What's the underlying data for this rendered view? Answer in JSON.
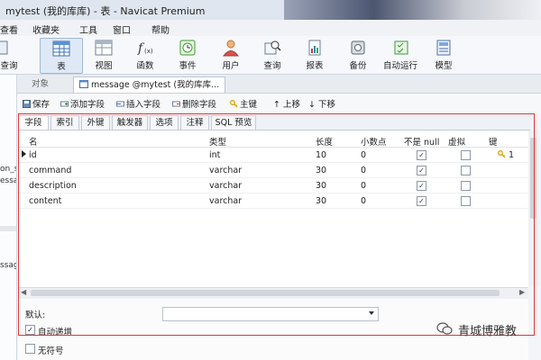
{
  "window": {
    "title": "mytest (我的库库) - 表 - Navicat Premium"
  },
  "menubar": {
    "items": [
      "查看",
      "收藏夹",
      "工具",
      "窗口",
      "帮助"
    ]
  },
  "toolbar": {
    "left_fragment": "查询",
    "buttons": [
      {
        "label": "表",
        "icon": "table-icon",
        "active": true
      },
      {
        "label": "视图",
        "icon": "view-icon"
      },
      {
        "label": "函数",
        "icon": "function-icon"
      },
      {
        "label": "事件",
        "icon": "event-clock-icon"
      },
      {
        "label": "用户",
        "icon": "user-icon"
      },
      {
        "label": "查询",
        "icon": "query-icon"
      },
      {
        "label": "报表",
        "icon": "report-icon"
      },
      {
        "label": "备份",
        "icon": "backup-icon"
      },
      {
        "label": "自动运行",
        "icon": "autorun-icon"
      },
      {
        "label": "模型",
        "icon": "model-icon"
      }
    ]
  },
  "leftpane": {
    "frag1": "on_s",
    "frag2": "essa",
    "frag3": "ssage"
  },
  "objtabs": {
    "objects": "对象",
    "editor": "message @mytest (我的库库..."
  },
  "actions": {
    "save": "保存",
    "add_field": "添加字段",
    "insert_field": "插入字段",
    "delete_field": "删除字段",
    "primary_key": "主键",
    "move_up": "上移",
    "move_down": "下移"
  },
  "subtabs": [
    "字段",
    "索引",
    "外键",
    "触发器",
    "选项",
    "注释",
    "SQL 预览"
  ],
  "grid": {
    "columns": [
      "名",
      "类型",
      "长度",
      "小数点",
      "不是 null",
      "虚拟",
      "键"
    ],
    "rows": [
      {
        "name": "id",
        "type": "int",
        "length": "10",
        "decimals": "0",
        "not_null": true,
        "virtual": false,
        "key": "1"
      },
      {
        "name": "command",
        "type": "varchar",
        "length": "30",
        "decimals": "0",
        "not_null": true,
        "virtual": false,
        "key": ""
      },
      {
        "name": "description",
        "type": "varchar",
        "length": "30",
        "decimals": "0",
        "not_null": true,
        "virtual": false,
        "key": ""
      },
      {
        "name": "content",
        "type": "varchar",
        "length": "30",
        "decimals": "0",
        "not_null": true,
        "virtual": false,
        "key": ""
      }
    ]
  },
  "props": {
    "default_label": "默认:",
    "auto_increment": "自动递增",
    "unsigned": "无符号"
  },
  "watermark": {
    "text": "青城博雅教"
  },
  "colors": {
    "highlight": "#e0363b",
    "key_icon": "#d9a400"
  }
}
